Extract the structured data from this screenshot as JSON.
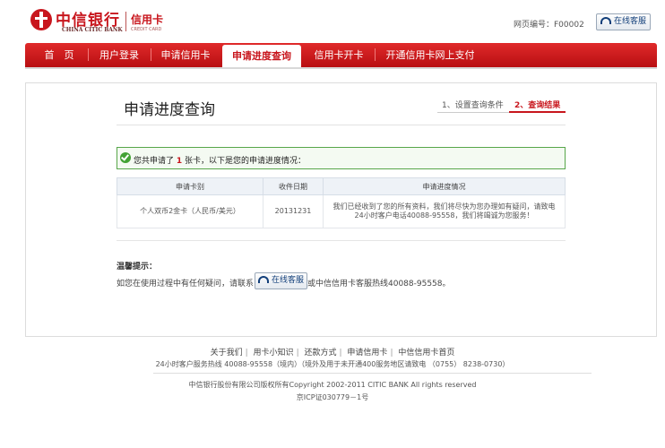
{
  "header": {
    "brand_cn": "中信银行",
    "brand_en": "CHINA CITIC BANK",
    "card_cn": "信用卡",
    "card_en": "CREDIT CARD",
    "page_no": "网页编号：F00002",
    "service_label": "在线客服"
  },
  "nav": {
    "items": [
      "首　页",
      "用户登录",
      "申请信用卡",
      "申请进度查询",
      "信用卡开卡",
      "开通信用卡网上支付"
    ],
    "active_index": 3
  },
  "main": {
    "title": "申请进度查询",
    "steps": [
      "1、设置查询条件",
      "2、查询结果"
    ],
    "active_step": 1,
    "notice_prefix": "您共申请了",
    "notice_count": "1",
    "notice_suffix": "张卡，以下是您的申请进度情况：",
    "table": {
      "headers": [
        "申请卡别",
        "收件日期",
        "申请进度情况"
      ],
      "rows": [
        [
          "个人双币2金卡（人民币/美元）",
          "20131231",
          "我们已经收到了您的所有资料，我们将尽快为您办理如有疑问，请致电24小时客户电话40088-95558，我们将竭诚为您服务！"
        ]
      ]
    },
    "tip_title": "温馨提示：",
    "tip_prefix": "如您在使用过程中有任何疑问，请联系",
    "tip_button": "在线客服",
    "tip_suffix": "或中信信用卡客服热线40088-95558。"
  },
  "footer": {
    "links": [
      "关于我们",
      "用卡小知识",
      "还款方式",
      "申请信用卡",
      "中信信用卡首页"
    ],
    "hotline": "24小时客户服务热线 40088-95558（境内）（境外及用于未开通400服务地区请致电 （0755） 8238-0730）",
    "copyright": "中信银行股份有限公司版权所有Copyright 2002-2011 CITIC BANK All rights reserved",
    "icp": "京ICP证030779－1号"
  },
  "colors": {
    "brand_red": "#c8161d",
    "notice_green": "#57a64a"
  }
}
